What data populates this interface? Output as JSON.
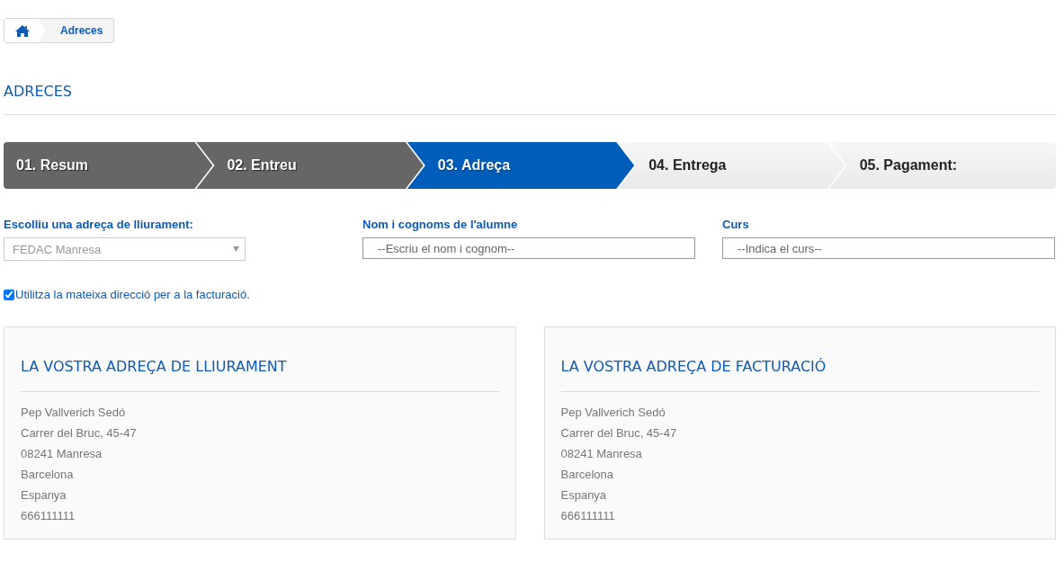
{
  "breadcrumb": {
    "items": [
      {
        "kind": "home"
      },
      {
        "kind": "text",
        "label": "Adreces"
      }
    ]
  },
  "page_title": "ADRECES",
  "steps": [
    {
      "label": "01. Resum",
      "completed": true,
      "selected": false
    },
    {
      "label": "02. Entreu",
      "completed": true,
      "selected": false
    },
    {
      "label": "03. Adreça",
      "completed": false,
      "selected": true
    },
    {
      "label": "04. Entrega",
      "completed": false,
      "selected": false
    },
    {
      "label": "05. Pagament:",
      "completed": false,
      "selected": false
    }
  ],
  "fields": [
    {
      "kind": "select",
      "label": "Escolliu una adreça de lliurament:",
      "value": "FEDAC Manresa",
      "disabled": true
    },
    {
      "kind": "text",
      "label": "Nom i cognoms de l'alumne",
      "placeholder": "--Escriu el nom i cognom--"
    },
    {
      "kind": "text",
      "label": "Curs",
      "placeholder": "--Indica el curs--"
    }
  ],
  "same_billing": {
    "label": "Utilitza la mateixa direcció per a la facturació.",
    "checked": true
  },
  "cards": [
    {
      "title": "LA VOSTRA ADREÇA DE LLIURAMENT",
      "lines": [
        "Pep Vallverich Sedó",
        "Carrer del Bruc, 45-47",
        "08241 Manresa",
        "Barcelona",
        "Espanya",
        "666111111"
      ]
    },
    {
      "title": "LA VOSTRA ADREÇA DE FACTURACIÓ",
      "lines": [
        "Pep Vallverich Sedó",
        "Carrer del Bruc, 45-47",
        "08241 Manresa",
        "Barcelona",
        "Espanya",
        "666111111"
      ]
    }
  ]
}
